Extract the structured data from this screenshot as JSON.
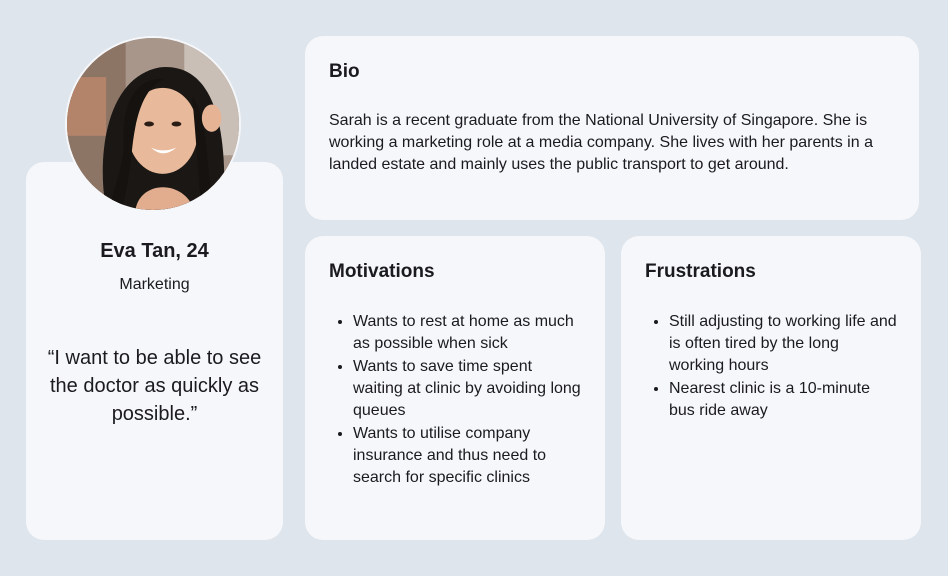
{
  "profile": {
    "name": "Eva Tan, 24",
    "role": "Marketing",
    "quote": "“I want to be able to see the doctor as quickly as possible.”"
  },
  "bio": {
    "title": "Bio",
    "text": "Sarah is a recent graduate from the National University of Singapore. She is working a marketing role at a media company. She lives with her parents in a landed estate and mainly uses the public transport to get around."
  },
  "motivations": {
    "title": "Motivations",
    "items": [
      "Wants to rest at home as much as possible when sick",
      "Wants to save time spent waiting at clinic by avoiding long queues",
      "Wants to utilise company insurance and thus need to search for specific clinics"
    ]
  },
  "frustrations": {
    "title": "Frustrations",
    "items": [
      "Still adjusting to working life and is often tired by the long working hours",
      "Nearest clinic is a 10-minute bus ride away"
    ]
  },
  "colors": {
    "background": "#dee5ec",
    "card": "#f5f7fa",
    "text": "#1b1b1f"
  }
}
